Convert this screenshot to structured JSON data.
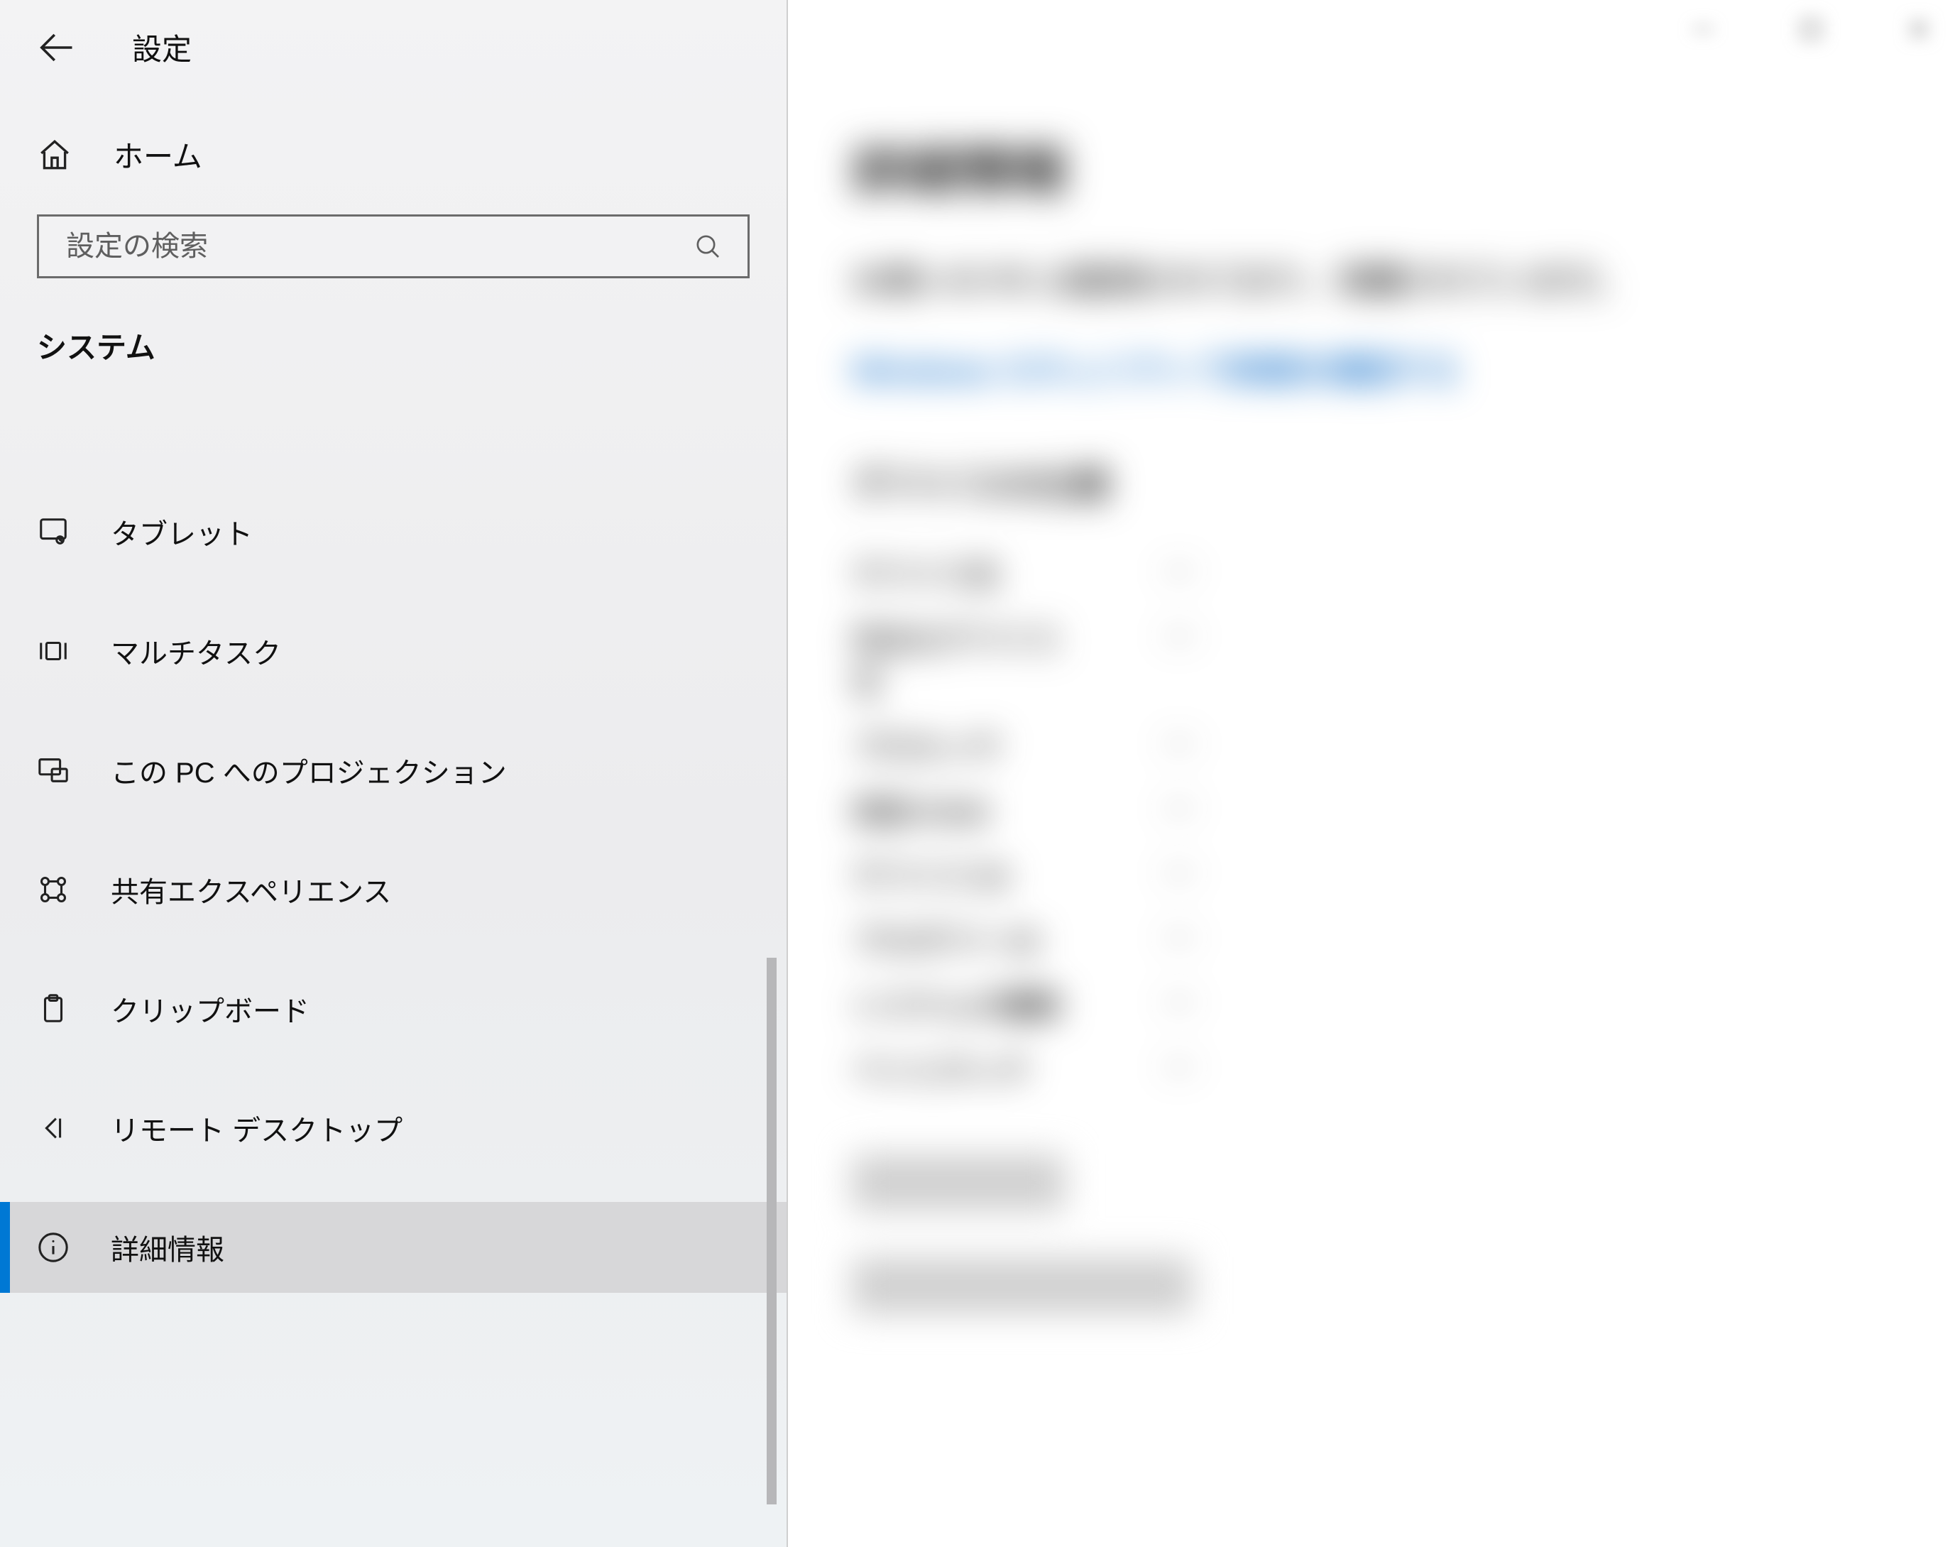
{
  "header": {
    "title": "設定"
  },
  "sidebar": {
    "home_label": "ホーム",
    "search_placeholder": "設定の検索",
    "section_label": "システム",
    "items": [
      {
        "icon": "tablet",
        "label": "タブレット"
      },
      {
        "icon": "multitask",
        "label": "マルチタスク"
      },
      {
        "icon": "project",
        "label": "この PC へのプロジェクション"
      },
      {
        "icon": "shared",
        "label": "共有エクスペリエンス"
      },
      {
        "icon": "clipboard",
        "label": "クリップボード"
      },
      {
        "icon": "remote",
        "label": "リモート デスクトップ"
      },
      {
        "icon": "info",
        "label": "詳細情報",
        "selected": true
      }
    ]
  },
  "main": {
    "title": "詳細情報",
    "status_line1": "お使いの PC は監視されており、保護されています。",
    "link": "Windows セキュリティで詳細を確認する",
    "spec_heading": "デバイスの仕様",
    "specs": [
      {
        "key": "デバイス名",
        "value": "—"
      },
      {
        "key": "完全なデバイス名",
        "value": "—"
      },
      {
        "key": "プロセッサ",
        "value": "—"
      },
      {
        "key": "実装 RAM",
        "value": "—"
      },
      {
        "key": "デバイス ID",
        "value": "—"
      },
      {
        "key": "プロダクト ID",
        "value": "—"
      },
      {
        "key": "システムの種類",
        "value": "—"
      },
      {
        "key": "ペンとタッチ",
        "value": "—"
      }
    ],
    "button1": "コピー",
    "button2": "この PC の名前を変更"
  }
}
